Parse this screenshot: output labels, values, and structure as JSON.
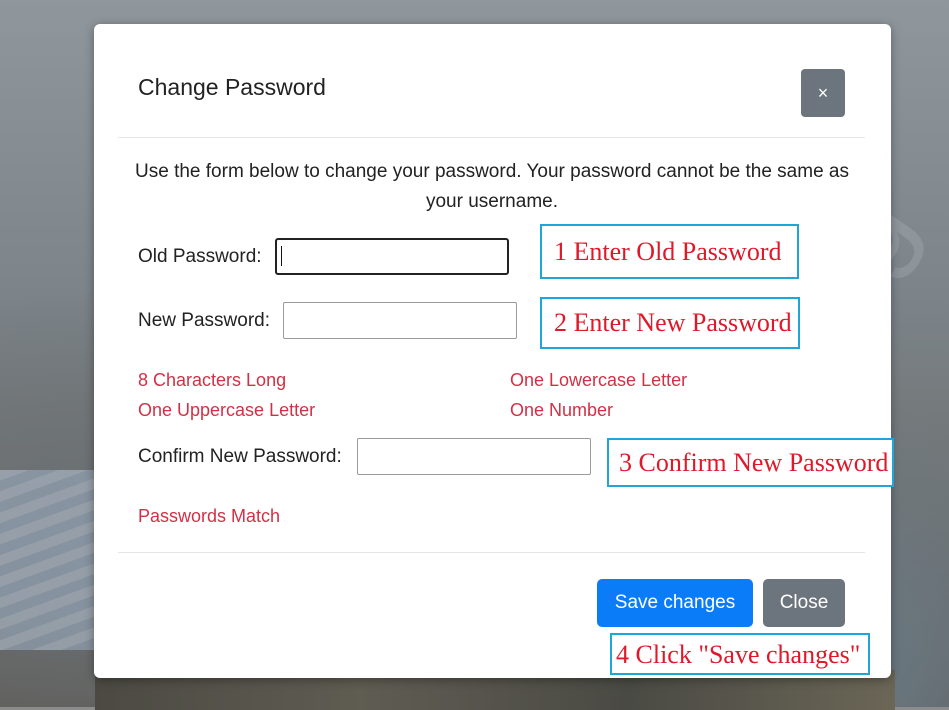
{
  "modal": {
    "title": "Change Password",
    "close_icon_glyph": "×",
    "intro": "Use the form below to change your password. Your password cannot be the same as your username."
  },
  "form": {
    "old_password": {
      "label": "Old Password:",
      "value": ""
    },
    "new_password": {
      "label": "New Password:",
      "value": ""
    },
    "confirm_password": {
      "label": "Confirm New Password:",
      "value": ""
    }
  },
  "requirements": {
    "length": "8 Characters Long",
    "lowercase": "One Lowercase Letter",
    "uppercase": "One Uppercase Letter",
    "number": "One Number",
    "match": "Passwords Match",
    "color": "#d23045"
  },
  "annotations": {
    "step1": "1 Enter Old Password",
    "step2": "2 Enter New Password",
    "step3": "3 Confirm New Password",
    "step4": "4 Click \"Save changes\"",
    "border_color": "#1fa6d8",
    "text_color": "#e0182a"
  },
  "footer": {
    "save_label": "Save changes",
    "close_label": "Close",
    "primary_color": "#0a7cf8",
    "secondary_color": "#6c757d"
  }
}
